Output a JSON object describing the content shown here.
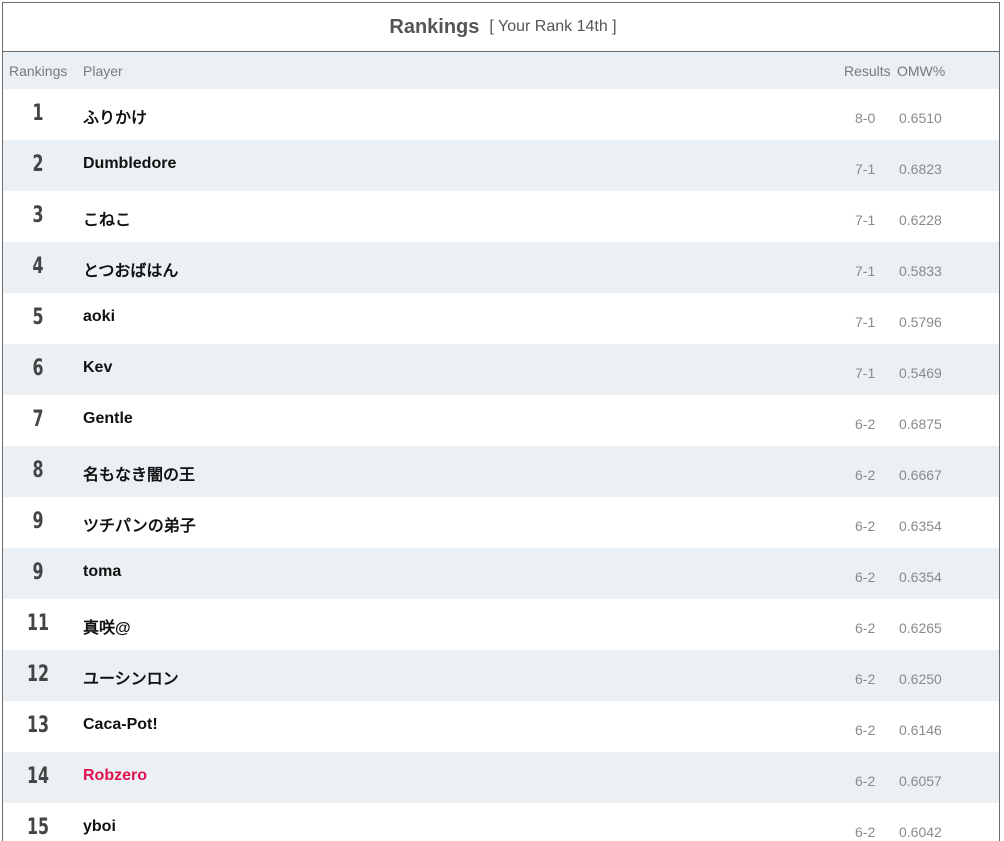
{
  "header": {
    "title": "Rankings",
    "subtitle": "[ Your Rank 14th ]"
  },
  "columns": {
    "rankings": "Rankings",
    "player": "Player",
    "results": "Results",
    "omw": "OMW%"
  },
  "highlight_color": "#e0104e",
  "rows": [
    {
      "rank": "1",
      "player": "ふりかけ",
      "result": "8-0",
      "omw": "0.6510"
    },
    {
      "rank": "2",
      "player": "Dumbledore",
      "result": "7-1",
      "omw": "0.6823"
    },
    {
      "rank": "3",
      "player": "こねこ",
      "result": "7-1",
      "omw": "0.6228"
    },
    {
      "rank": "4",
      "player": "とつおばはん",
      "result": "7-1",
      "omw": "0.5833"
    },
    {
      "rank": "5",
      "player": "aoki",
      "result": "7-1",
      "omw": "0.5796"
    },
    {
      "rank": "6",
      "player": "Kev",
      "result": "7-1",
      "omw": "0.5469"
    },
    {
      "rank": "7",
      "player": "Gentle",
      "result": "6-2",
      "omw": "0.6875"
    },
    {
      "rank": "8",
      "player": "名もなき闇の王",
      "result": "6-2",
      "omw": "0.6667"
    },
    {
      "rank": "9",
      "player": "ツチパンの弟子",
      "result": "6-2",
      "omw": "0.6354"
    },
    {
      "rank": "9",
      "player": "toma",
      "result": "6-2",
      "omw": "0.6354"
    },
    {
      "rank": "11",
      "player": "真咲@",
      "result": "6-2",
      "omw": "0.6265"
    },
    {
      "rank": "12",
      "player": "ユーシンロン",
      "result": "6-2",
      "omw": "0.6250"
    },
    {
      "rank": "13",
      "player": "Caca-Pot!",
      "result": "6-2",
      "omw": "0.6146"
    },
    {
      "rank": "14",
      "player": "Robzero",
      "result": "6-2",
      "omw": "0.6057",
      "is_me": true
    },
    {
      "rank": "15",
      "player": "yboi",
      "result": "6-2",
      "omw": "0.6042"
    }
  ]
}
